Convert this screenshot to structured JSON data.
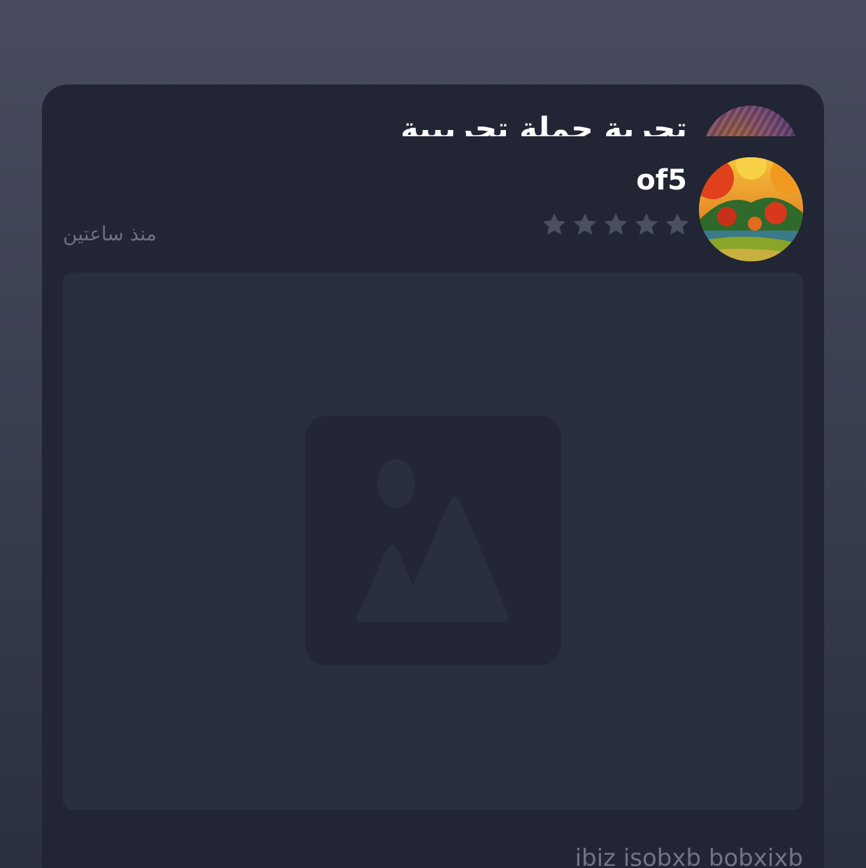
{
  "post": {
    "title": "تجربة حملة تجريبية",
    "author": {
      "name": "of5",
      "rating": 0,
      "rating_max": 5
    },
    "timestamp": "منذ ساعتين",
    "body_text": "ibiz isobxb bobxixb"
  },
  "icons": {
    "star": "star-icon",
    "image_placeholder": "image-placeholder-icon"
  },
  "colors": {
    "background_top": "#484c5e",
    "card": "#212534",
    "media_box": "#2a2f3f",
    "star_empty": "#4a4f62",
    "muted_text": "#6b7084"
  }
}
